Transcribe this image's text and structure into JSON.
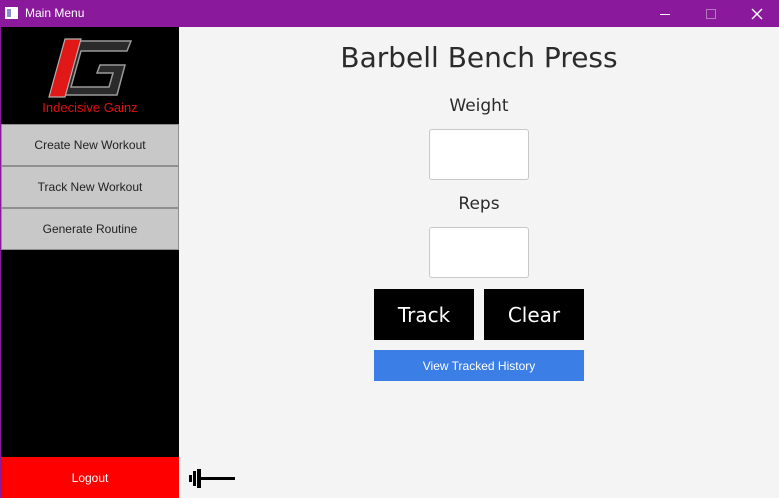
{
  "window": {
    "title": "Main Menu",
    "accent": "#8a1a9b",
    "controls": [
      "minimize-icon",
      "maximize-icon",
      "close-icon"
    ]
  },
  "sidebar": {
    "brand": "Indecisive Gainz",
    "brand_color": "#e01010",
    "logo_icon": "ig-logo-icon",
    "items": [
      {
        "label": "Create New Workout"
      },
      {
        "label": "Track New Workout"
      },
      {
        "label": "Generate Routine"
      }
    ],
    "logout_label": "Logout",
    "logout_color": "#ff0000"
  },
  "main": {
    "exercise_title": "Barbell Bench Press",
    "weight_label": "Weight",
    "weight_value": "",
    "reps_label": "Reps",
    "reps_value": "",
    "track_label": "Track",
    "clear_label": "Clear",
    "history_label": "View Tracked History",
    "history_color": "#3a7ee6",
    "footer_icon": "barbell-icon"
  }
}
